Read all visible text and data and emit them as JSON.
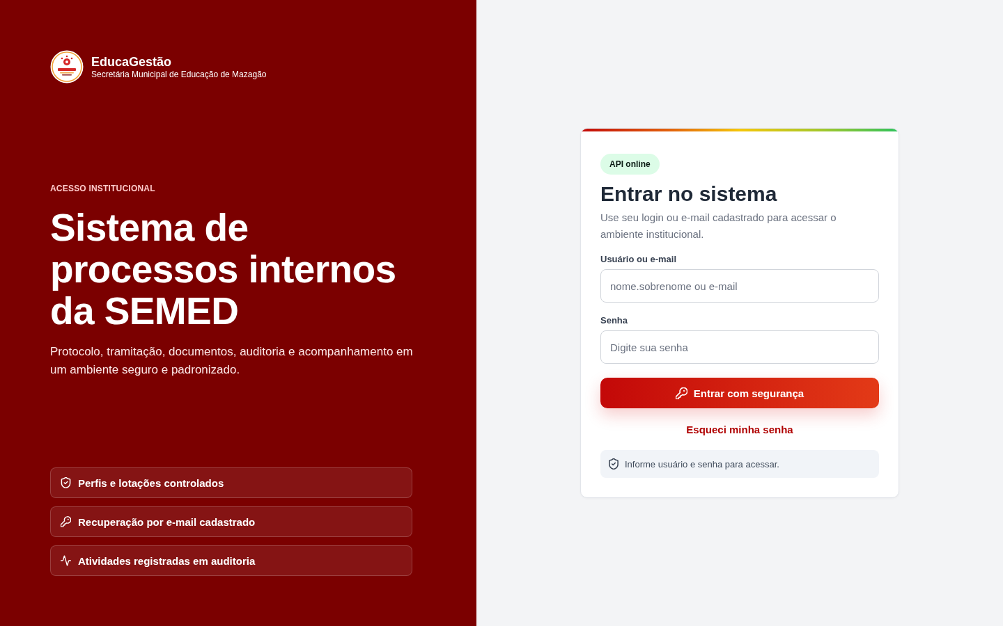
{
  "brand": {
    "name": "EducaGestão",
    "subtitle": "Secretária Municipal de Educação de Mazagão"
  },
  "hero": {
    "eyebrow": "ACESSO INSTITUCIONAL",
    "title": "Sistema de processos internos da SEMED",
    "description": "Protocolo, tramitação, documentos, auditoria e acompanhamento em um ambiente seguro e padronizado."
  },
  "features": [
    {
      "kind": "shield",
      "label": "Perfis e lotações controlados"
    },
    {
      "kind": "key",
      "label": "Recuperação por e-mail cadastrado"
    },
    {
      "kind": "activity",
      "label": "Atividades registradas em auditoria"
    }
  ],
  "login": {
    "status_badge": "API online",
    "title": "Entrar no sistema",
    "description": "Use seu login ou e-mail cadastrado para acessar o ambiente institucional.",
    "fields": [
      {
        "label": "Usuário ou e-mail",
        "placeholder": "nome.sobrenome ou e-mail"
      },
      {
        "label": "Senha",
        "placeholder": "Digite sua senha"
      }
    ],
    "submit_button": "Entrar com segurança",
    "forgot_link": "Esqueci minha senha",
    "notice": "Informe usuário e senha para acessar."
  }
}
